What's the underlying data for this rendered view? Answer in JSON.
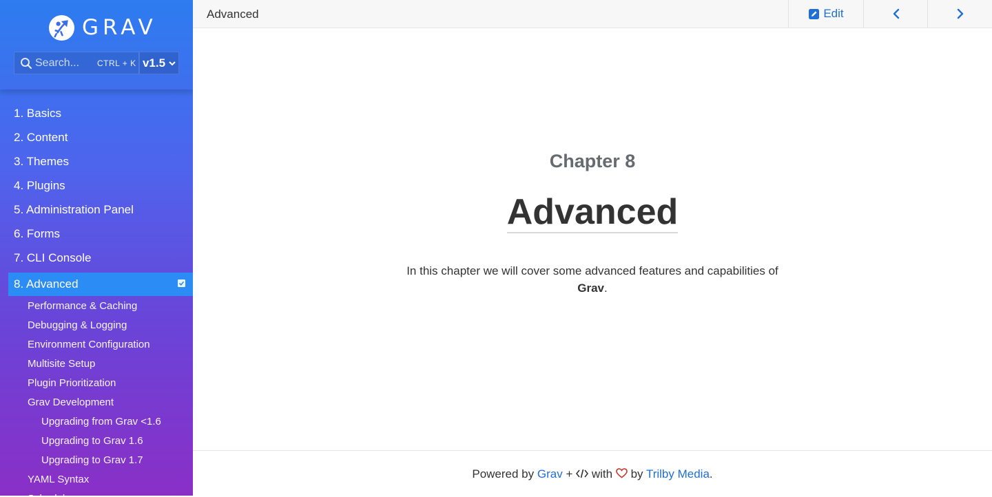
{
  "sidebar": {
    "logo_text": "GRAV",
    "search": {
      "placeholder": "Search...",
      "shortcut": "CTRL + K"
    },
    "version": "v1.5",
    "nav_items": [
      {
        "label": "1. Basics"
      },
      {
        "label": "2. Content"
      },
      {
        "label": "3. Themes"
      },
      {
        "label": "4. Plugins"
      },
      {
        "label": "5. Administration Panel"
      },
      {
        "label": "6. Forms"
      },
      {
        "label": "7. CLI Console"
      }
    ],
    "active_item": {
      "label": "8. Advanced"
    },
    "sub_items": [
      {
        "label": "Performance & Caching"
      },
      {
        "label": "Debugging & Logging"
      },
      {
        "label": "Environment Configuration"
      },
      {
        "label": "Multisite Setup"
      },
      {
        "label": "Plugin Prioritization"
      },
      {
        "label": "Grav Development"
      }
    ],
    "sub_sub_items": [
      {
        "label": "Upgrading from Grav <1.6"
      },
      {
        "label": "Upgrading to Grav 1.6"
      },
      {
        "label": "Upgrading to Grav 1.7"
      }
    ],
    "trailing_items": [
      {
        "label": "YAML Syntax"
      },
      {
        "label": "Scheduler"
      }
    ]
  },
  "topbar": {
    "breadcrumb": "Advanced",
    "edit_label": "Edit"
  },
  "main": {
    "chapter_label": "Chapter 8",
    "chapter_title": "Advanced",
    "description_prefix": "In this chapter we will cover some advanced features and capabilities of",
    "description_bold": "Grav",
    "description_suffix": "."
  },
  "footer": {
    "powered_by": "Powered by",
    "grav_link": "Grav",
    "plus": "+",
    "with": "with",
    "by": "by",
    "trilby_link": "Trilby Media",
    "end": "."
  },
  "colors": {
    "accent": "#1f6fd6",
    "active_nav": "#2a8cf4",
    "sidebar_top": "#2d7cf0",
    "sidebar_bottom": "#8a2fc6",
    "heart": "#c0392b"
  },
  "icons": [
    "grav-logo-icon",
    "search-icon",
    "chevron-down-icon",
    "check-square-icon",
    "edit-icon",
    "chevron-left-icon",
    "chevron-right-icon",
    "code-icon",
    "heart-icon"
  ]
}
